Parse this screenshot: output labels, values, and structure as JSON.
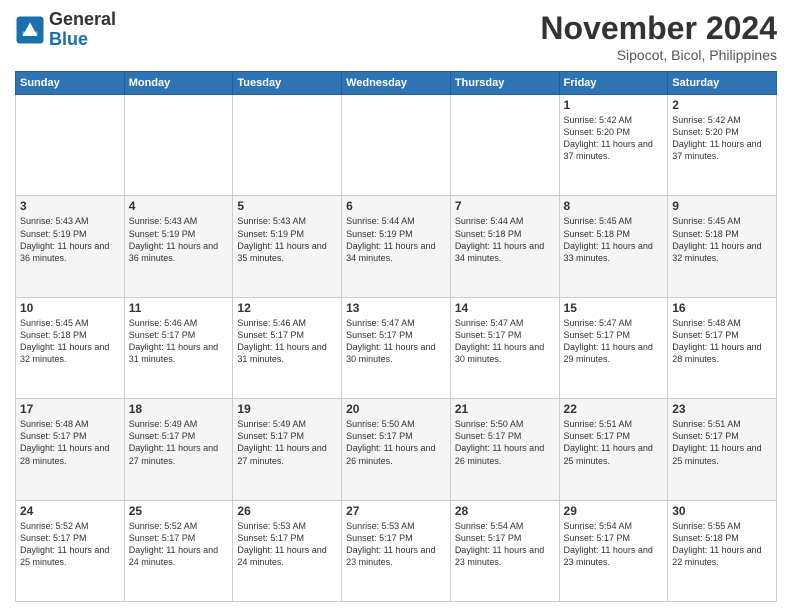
{
  "header": {
    "logo_general": "General",
    "logo_blue": "Blue",
    "month": "November 2024",
    "location": "Sipocot, Bicol, Philippines"
  },
  "weekdays": [
    "Sunday",
    "Monday",
    "Tuesday",
    "Wednesday",
    "Thursday",
    "Friday",
    "Saturday"
  ],
  "weeks": [
    [
      {
        "day": "",
        "info": ""
      },
      {
        "day": "",
        "info": ""
      },
      {
        "day": "",
        "info": ""
      },
      {
        "day": "",
        "info": ""
      },
      {
        "day": "",
        "info": ""
      },
      {
        "day": "1",
        "info": "Sunrise: 5:42 AM\nSunset: 5:20 PM\nDaylight: 11 hours and 37 minutes."
      },
      {
        "day": "2",
        "info": "Sunrise: 5:42 AM\nSunset: 5:20 PM\nDaylight: 11 hours and 37 minutes."
      }
    ],
    [
      {
        "day": "3",
        "info": "Sunrise: 5:43 AM\nSunset: 5:19 PM\nDaylight: 11 hours and 36 minutes."
      },
      {
        "day": "4",
        "info": "Sunrise: 5:43 AM\nSunset: 5:19 PM\nDaylight: 11 hours and 36 minutes."
      },
      {
        "day": "5",
        "info": "Sunrise: 5:43 AM\nSunset: 5:19 PM\nDaylight: 11 hours and 35 minutes."
      },
      {
        "day": "6",
        "info": "Sunrise: 5:44 AM\nSunset: 5:19 PM\nDaylight: 11 hours and 34 minutes."
      },
      {
        "day": "7",
        "info": "Sunrise: 5:44 AM\nSunset: 5:18 PM\nDaylight: 11 hours and 34 minutes."
      },
      {
        "day": "8",
        "info": "Sunrise: 5:45 AM\nSunset: 5:18 PM\nDaylight: 11 hours and 33 minutes."
      },
      {
        "day": "9",
        "info": "Sunrise: 5:45 AM\nSunset: 5:18 PM\nDaylight: 11 hours and 32 minutes."
      }
    ],
    [
      {
        "day": "10",
        "info": "Sunrise: 5:45 AM\nSunset: 5:18 PM\nDaylight: 11 hours and 32 minutes."
      },
      {
        "day": "11",
        "info": "Sunrise: 5:46 AM\nSunset: 5:17 PM\nDaylight: 11 hours and 31 minutes."
      },
      {
        "day": "12",
        "info": "Sunrise: 5:46 AM\nSunset: 5:17 PM\nDaylight: 11 hours and 31 minutes."
      },
      {
        "day": "13",
        "info": "Sunrise: 5:47 AM\nSunset: 5:17 PM\nDaylight: 11 hours and 30 minutes."
      },
      {
        "day": "14",
        "info": "Sunrise: 5:47 AM\nSunset: 5:17 PM\nDaylight: 11 hours and 30 minutes."
      },
      {
        "day": "15",
        "info": "Sunrise: 5:47 AM\nSunset: 5:17 PM\nDaylight: 11 hours and 29 minutes."
      },
      {
        "day": "16",
        "info": "Sunrise: 5:48 AM\nSunset: 5:17 PM\nDaylight: 11 hours and 28 minutes."
      }
    ],
    [
      {
        "day": "17",
        "info": "Sunrise: 5:48 AM\nSunset: 5:17 PM\nDaylight: 11 hours and 28 minutes."
      },
      {
        "day": "18",
        "info": "Sunrise: 5:49 AM\nSunset: 5:17 PM\nDaylight: 11 hours and 27 minutes."
      },
      {
        "day": "19",
        "info": "Sunrise: 5:49 AM\nSunset: 5:17 PM\nDaylight: 11 hours and 27 minutes."
      },
      {
        "day": "20",
        "info": "Sunrise: 5:50 AM\nSunset: 5:17 PM\nDaylight: 11 hours and 26 minutes."
      },
      {
        "day": "21",
        "info": "Sunrise: 5:50 AM\nSunset: 5:17 PM\nDaylight: 11 hours and 26 minutes."
      },
      {
        "day": "22",
        "info": "Sunrise: 5:51 AM\nSunset: 5:17 PM\nDaylight: 11 hours and 25 minutes."
      },
      {
        "day": "23",
        "info": "Sunrise: 5:51 AM\nSunset: 5:17 PM\nDaylight: 11 hours and 25 minutes."
      }
    ],
    [
      {
        "day": "24",
        "info": "Sunrise: 5:52 AM\nSunset: 5:17 PM\nDaylight: 11 hours and 25 minutes."
      },
      {
        "day": "25",
        "info": "Sunrise: 5:52 AM\nSunset: 5:17 PM\nDaylight: 11 hours and 24 minutes."
      },
      {
        "day": "26",
        "info": "Sunrise: 5:53 AM\nSunset: 5:17 PM\nDaylight: 11 hours and 24 minutes."
      },
      {
        "day": "27",
        "info": "Sunrise: 5:53 AM\nSunset: 5:17 PM\nDaylight: 11 hours and 23 minutes."
      },
      {
        "day": "28",
        "info": "Sunrise: 5:54 AM\nSunset: 5:17 PM\nDaylight: 11 hours and 23 minutes."
      },
      {
        "day": "29",
        "info": "Sunrise: 5:54 AM\nSunset: 5:17 PM\nDaylight: 11 hours and 23 minutes."
      },
      {
        "day": "30",
        "info": "Sunrise: 5:55 AM\nSunset: 5:18 PM\nDaylight: 11 hours and 22 minutes."
      }
    ]
  ]
}
